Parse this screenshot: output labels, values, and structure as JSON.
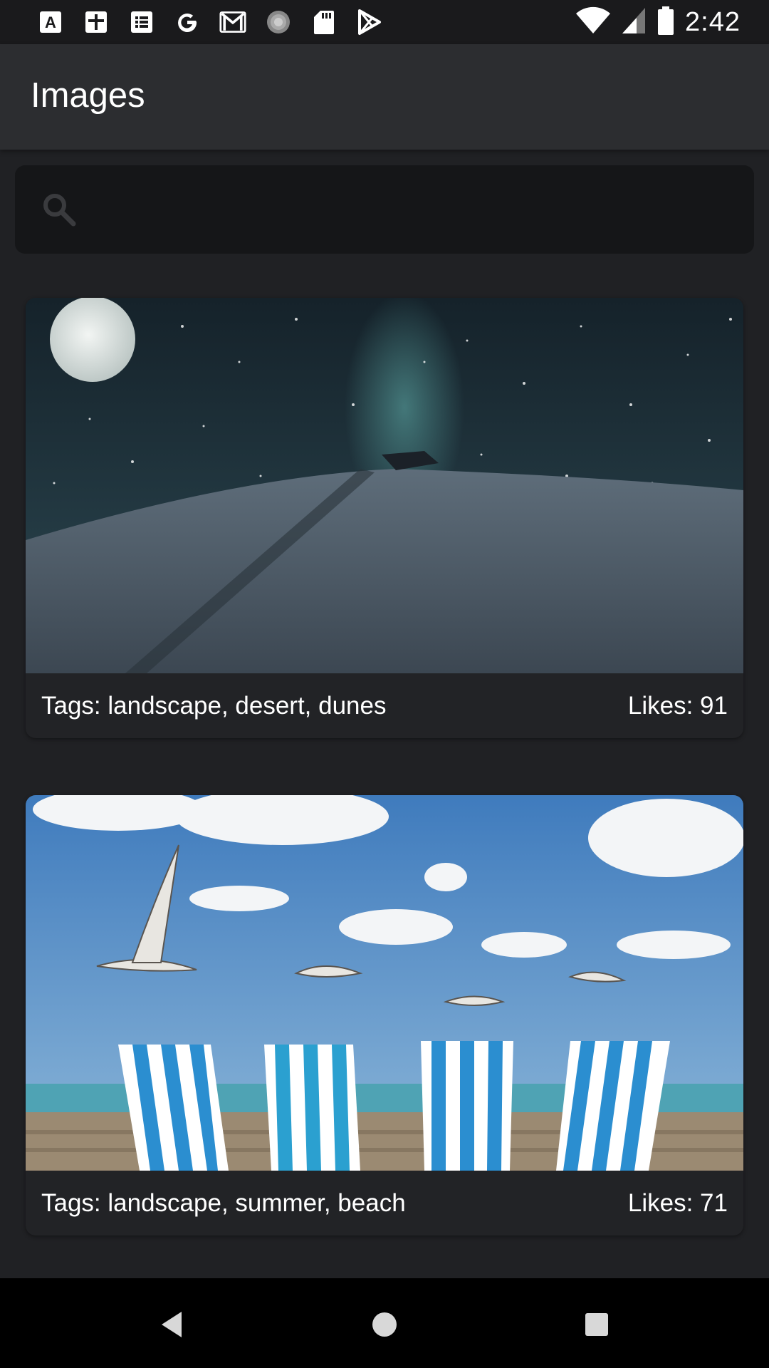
{
  "status_bar": {
    "time": "2:42",
    "left_icons": [
      "a-icon",
      "plus-box-icon",
      "list-icon",
      "google-icon",
      "gmail-icon",
      "circle-progress-icon",
      "sd-card-icon",
      "play-store-icon"
    ],
    "right_icons": [
      "wifi-icon",
      "signal-icon",
      "battery-icon"
    ]
  },
  "app_bar": {
    "title": "Images"
  },
  "search": {
    "placeholder": "",
    "value": ""
  },
  "cards": [
    {
      "tags": "Tags: landscape, desert, dunes",
      "likes": "Likes: 91",
      "image": "night desert with moon and milky way"
    },
    {
      "tags": "Tags: landscape, summer, beach",
      "likes": "Likes: 71",
      "image": "beach chairs with seagulls"
    }
  ],
  "nav_bar": {
    "buttons": [
      "back",
      "home",
      "recents"
    ]
  },
  "colors": {
    "background": "#202124",
    "app_bar": "#2c2d30",
    "search_bg": "#151618",
    "card_bg": "#222326"
  }
}
